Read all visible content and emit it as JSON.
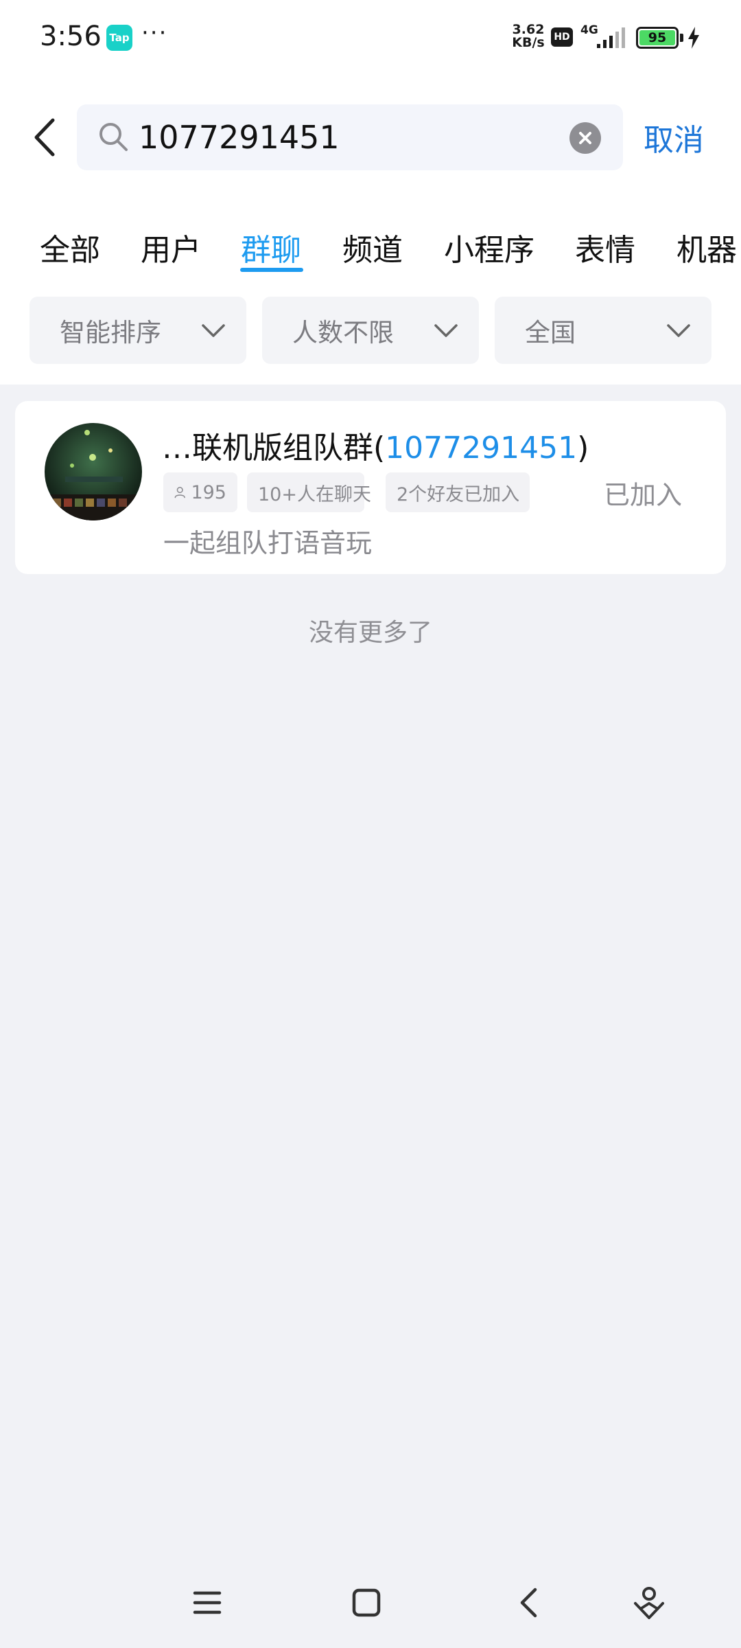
{
  "status_bar": {
    "time": "3:56",
    "tap_badge": "Tap",
    "more_dots": "···",
    "speed_value": "3.62",
    "speed_unit": "KB/s",
    "hd": "HD",
    "network": "4G",
    "battery": "95",
    "battery_level_percent": 95
  },
  "search": {
    "query": "1077291451",
    "cancel_label": "取消"
  },
  "tabs": [
    {
      "label": "全部",
      "active": false
    },
    {
      "label": "用户",
      "active": false
    },
    {
      "label": "群聊",
      "active": true
    },
    {
      "label": "频道",
      "active": false
    },
    {
      "label": "小程序",
      "active": false
    },
    {
      "label": "表情",
      "active": false
    },
    {
      "label": "机器",
      "active": false
    }
  ],
  "filters": [
    {
      "label": "智能排序"
    },
    {
      "label": "人数不限"
    },
    {
      "label": "全国"
    }
  ],
  "results": [
    {
      "name_prefix": "…联机版组队群(",
      "name_id": "1077291451",
      "name_suffix": ")",
      "member_count": "195",
      "chatting": "10+人在聊天",
      "friends_joined": "2个好友已加入",
      "status": "已加入",
      "description": "一起组队打语音玩"
    }
  ],
  "footer_text": "没有更多了",
  "colors": {
    "accent": "#1d9bf0",
    "link": "#1d8ee8",
    "cancel": "#1d76d8",
    "background": "#f1f2f6",
    "battery_fill": "#4cd964"
  },
  "icons": [
    "back-arrow-icon",
    "search-icon",
    "clear-icon",
    "chevron-down-icon",
    "person-icon",
    "menu-icon",
    "home-icon",
    "back-icon",
    "assistant-icon"
  ]
}
